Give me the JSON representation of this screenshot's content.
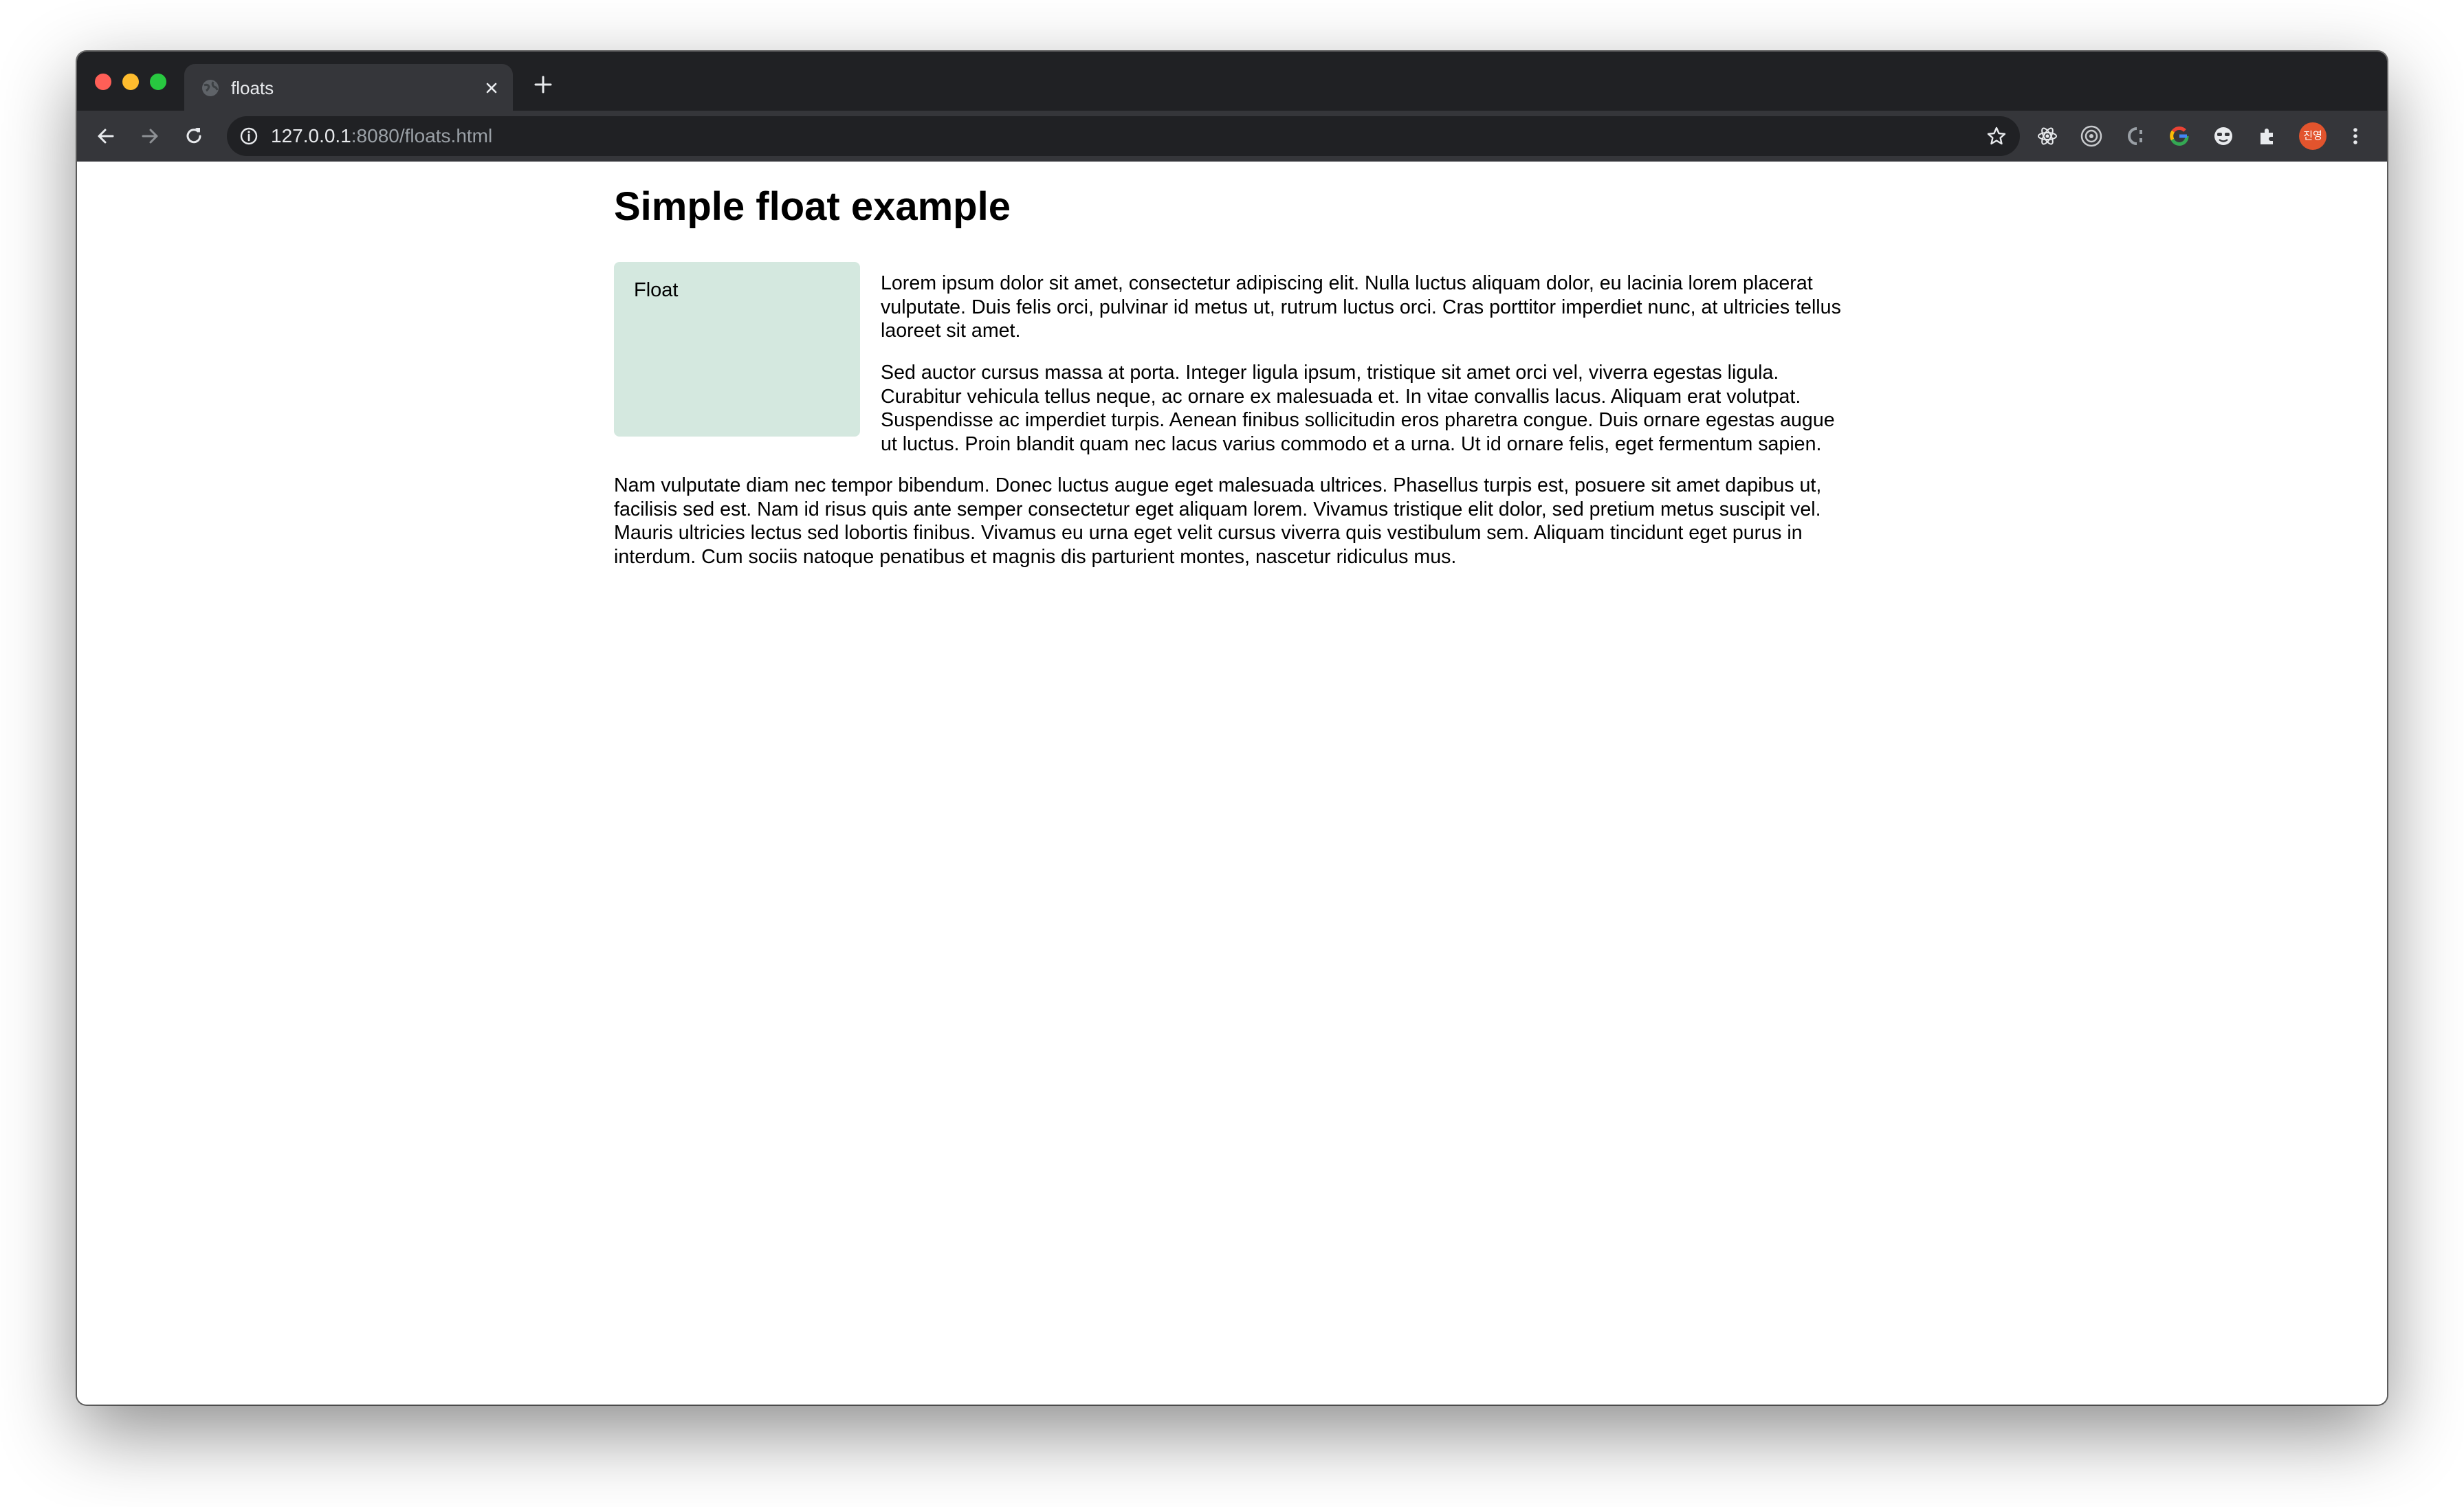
{
  "browser": {
    "tab": {
      "title": "floats",
      "favicon": "globe-icon"
    },
    "omnibox": {
      "url_host": "127.0.0.1",
      "url_rest": ":8080/floats.html"
    },
    "toolbar_icons": [
      "back-icon",
      "forward-icon",
      "reload-icon",
      "star-icon",
      "react-devtools-icon",
      "target-icon",
      "css-icon",
      "google-icon",
      "face-icon",
      "extensions-icon",
      "menu-icon"
    ],
    "avatar_text": "진영",
    "colors": {
      "frame": "#202124",
      "toolbar": "#35363a",
      "avatar": "#e2542d"
    }
  },
  "page": {
    "title": "Simple float example",
    "float_label": "Float",
    "float_color": "#d4e8df",
    "paragraph1": [
      "Lorem ipsum dolor sit amet, consectetur adipiscing elit. Nulla luctus aliquam dolor, eu lacinia lorem placerat",
      "vulputate. Duis felis orci, pulvinar id metus ut, rutrum luctus orci. Cras porttitor imperdiet nunc, at ultricies tellus",
      "laoreet sit amet."
    ],
    "paragraph2": [
      "Sed auctor cursus massa at porta. Integer ligula ipsum, tristique sit amet orci vel, viverra egestas ligula.",
      "Curabitur vehicula tellus neque, ac ornare ex malesuada et. In vitae convallis lacus. Aliquam erat volutpat.",
      "Suspendisse ac imperdiet turpis. Aenean finibus sollicitudin eros pharetra congue. Duis ornare egestas augue",
      "ut luctus. Proin blandit quam nec lacus varius commodo et a urna. Ut id ornare felis, eget fermentum sapien."
    ],
    "paragraph3": [
      "Nam vulputate diam nec tempor bibendum. Donec luctus augue eget malesuada ultrices. Phasellus turpis est, posuere sit amet dapibus ut,",
      "facilisis sed est. Nam id risus quis ante semper consectetur eget aliquam lorem. Vivamus tristique elit dolor, sed pretium metus suscipit vel.",
      "Mauris ultricies lectus sed lobortis finibus. Vivamus eu urna eget velit cursus viverra quis vestibulum sem. Aliquam tincidunt eget purus in",
      "interdum. Cum sociis natoque penatibus et magnis dis parturient montes, nascetur ridiculus mus."
    ]
  }
}
